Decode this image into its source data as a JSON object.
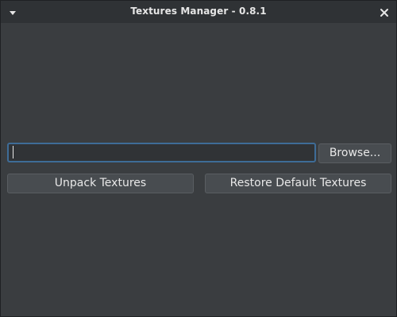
{
  "window": {
    "title": "Textures Manager - 0.8.1",
    "menu_icon": "triangle-down-icon",
    "close_icon": "close-icon"
  },
  "path_field": {
    "value": "",
    "placeholder": ""
  },
  "buttons": {
    "browse": "Browse...",
    "unpack": "Unpack Textures",
    "restore": "Restore Default Textures"
  },
  "colors": {
    "background": "#3a3d40",
    "titlebar": "#2f3235",
    "focus_border": "#3e6c97",
    "button": "#484c50",
    "text": "#e6e6e6"
  }
}
